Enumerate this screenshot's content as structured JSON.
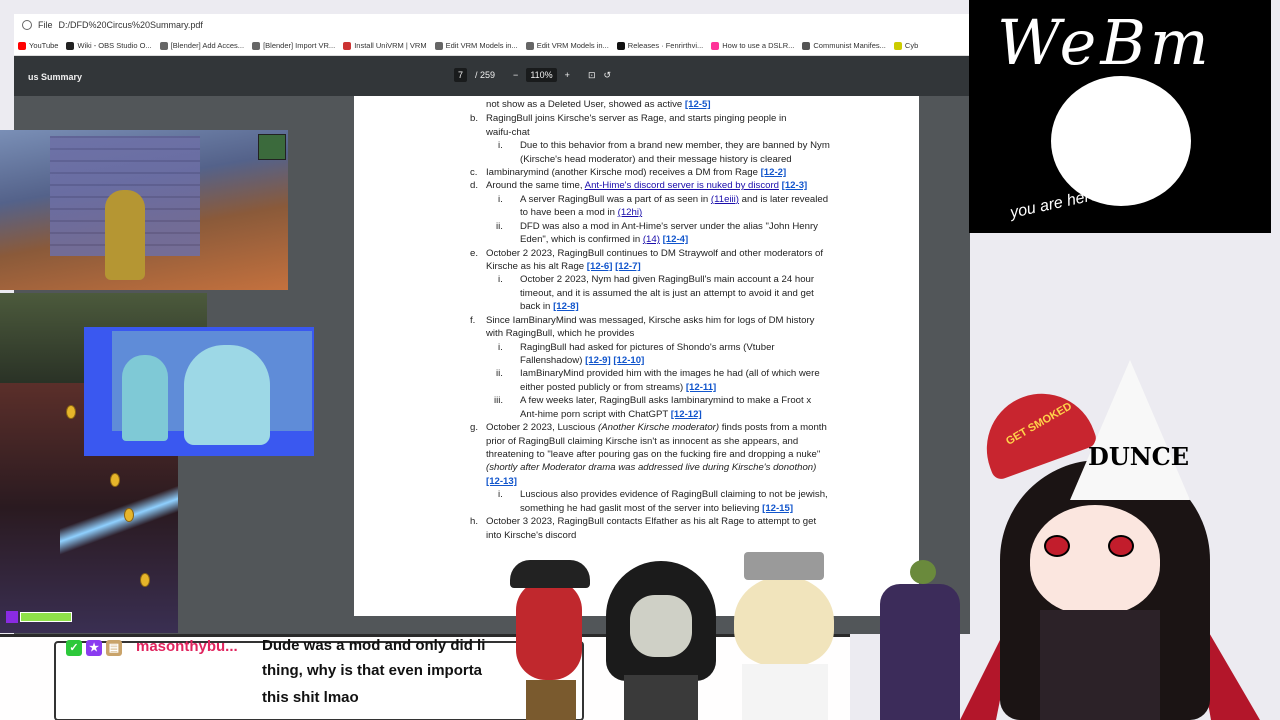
{
  "browser": {
    "url": "D:/DFD%20Circus%20Summary.pdf",
    "file_label": "File",
    "bookmarks": [
      "YouTube",
      "Wiki - OBS Studio O...",
      "[Blender] Add Acces...",
      "[Blender] Import VR...",
      "Install UniVRM | VRM",
      "Edit VRM Models in...",
      "Edit VRM Models in...",
      "Releases · Fenrirthvi...",
      "How to use a DSLR...",
      "Communist Manifes...",
      "Cyb"
    ]
  },
  "pdf_toolbar": {
    "title": "us Summary",
    "page_current": "7",
    "page_total": "/ 259",
    "zoom": "110%",
    "zoom_out_icon": "minus-icon",
    "zoom_in_icon": "plus-icon"
  },
  "document": {
    "l01": "not show as a Deleted User, showed as active",
    "r01": "[12-5]",
    "m02": "b.",
    "l02": "RagingBull joins Kirsche's server as Rage, and starts pinging people in",
    "l03": "waifu-chat",
    "m04": "i.",
    "l04": "Due to this behavior from a brand new member, they are banned by Nym",
    "l05": "(Kirsche's head moderator) and their message history is cleared",
    "m06": "c.",
    "l06": "Iambinarymind (another Kirsche mod) receives a DM from Rage",
    "r06": "[12-2]",
    "m07": "d.",
    "l07a": "Around the same time,",
    "l07b": "Ant-Hime's discord server is nuked by discord",
    "r07": "[12-3]",
    "m08": "i.",
    "l08a": "A server RagingBull was a part of as seen in",
    "l08b": "(11eiii)",
    "l08c": "and is later revealed",
    "l09a": "to have been a mod in",
    "l09b": "(12hi)",
    "m10": "ii.",
    "l10": "DFD was also a mod in Ant-Hime's server under the alias \"John Henry",
    "l11a": "Eden\", which is confirmed in",
    "l11b": "(14)",
    "r11": "[12-4]",
    "m12": "e.",
    "l12": "October 2 2023, RagingBull continues to DM Straywolf and other moderators of",
    "l13": "Kirsche as his alt Rage",
    "r13a": "[12-6]",
    "r13b": "[12-7]",
    "m14": "i.",
    "l14": "October 2 2023, Nym had given RagingBull's main account a 24 hour",
    "l15": "timeout, and it is assumed the alt is just an attempt to avoid it and get",
    "l16": "back in",
    "r16": "[12-8]",
    "m17": "f.",
    "l17": "Since IamBinaryMind was messaged, Kirsche asks him for logs of DM history",
    "l18": "with RagingBull, which he provides",
    "m19": "i.",
    "l19": "RagingBull had asked for pictures of Shondo's arms (Vtuber",
    "l20": "Fallenshadow)",
    "r20a": "[12-9]",
    "r20b": "[12-10]",
    "m21": "ii.",
    "l21": "IamBinaryMind provided him with the images he had (all of which were",
    "l22": "either posted publicly or from streams)",
    "r22": "[12-11]",
    "m23": "iii.",
    "l23": "A few weeks later, RagingBull asks Iambinarymind to make a Froot x",
    "l24": "Ant-hime porn script with ChatGPT",
    "r24": "[12-12]",
    "m25": "g.",
    "l25a": "October 2 2023, Luscious",
    "l25b": "(Another Kirsche moderator)",
    "l25c": "finds posts from a month",
    "l26": "prior of RagingBull claiming Kirsche isn't as innocent as she appears, and",
    "l27": "threatening to \"leave after pouring gas on the fucking fire and dropping a nuke\"",
    "l28": "(shortly after Moderator drama was addressed live during Kirsche's donothon)",
    "r29": "[12-13]",
    "m30": "i.",
    "l30": "Luscious also provides evidence of RagingBull claiming to not be jewish,",
    "l31": "something he had gaslit most of the server into believing",
    "r31": "[12-15]",
    "m32": "h.",
    "l32": "October 3 2023, RagingBull contacts Elfather as his alt Rage to attempt to get",
    "l33": "into Kirsche's discord"
  },
  "logo": {
    "title": "WeBm",
    "subtitle": "you are here forever"
  },
  "chat": {
    "username": "masonthybu...",
    "message_line1": "Dude was a mod and only did li",
    "message_line2": "thing, why is that even importa",
    "message_line3": "this shit lmao"
  },
  "avatar": {
    "cap_text": "GET SMOKED",
    "hat_text": "DUNCE"
  },
  "colors": {
    "link": "#1a0dab",
    "ref": "#1155cc",
    "username": "#e0245e",
    "webm_bg": "#000000"
  }
}
